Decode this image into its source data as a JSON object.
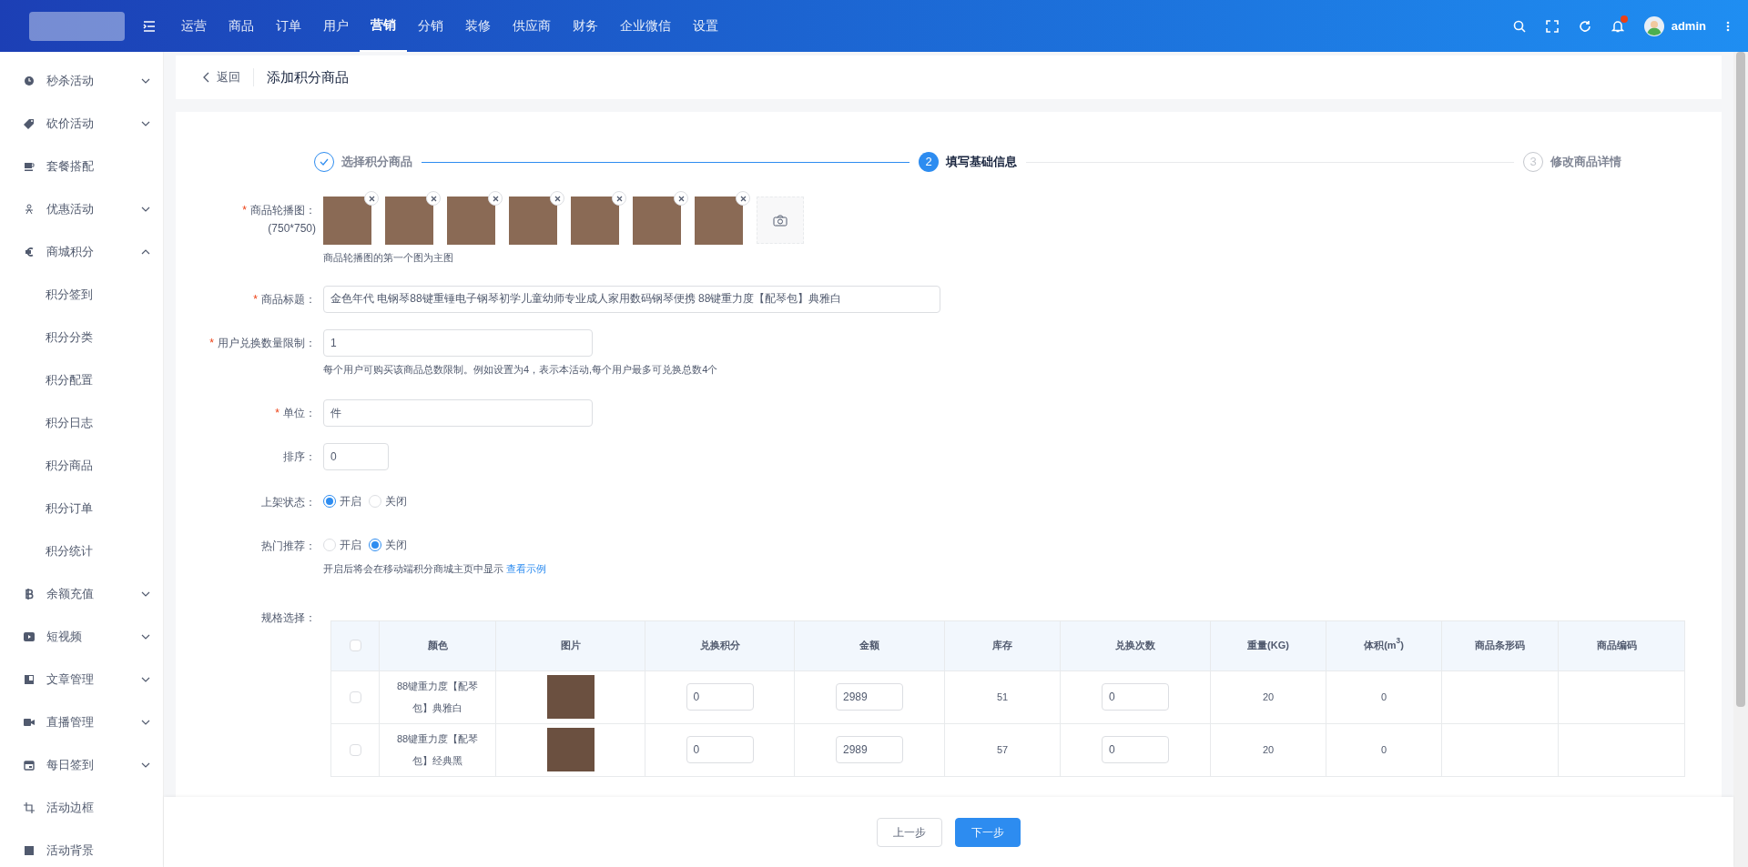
{
  "top_nav": {
    "menu": [
      {
        "label": "运营",
        "selected": false
      },
      {
        "label": "商品",
        "selected": false
      },
      {
        "label": "订单",
        "selected": false
      },
      {
        "label": "用户",
        "selected": false
      },
      {
        "label": "营销",
        "selected": true
      },
      {
        "label": "分销",
        "selected": false
      },
      {
        "label": "装修",
        "selected": false
      },
      {
        "label": "供应商",
        "selected": false
      },
      {
        "label": "财务",
        "selected": false
      },
      {
        "label": "企业微信",
        "selected": false
      },
      {
        "label": "设置",
        "selected": false
      }
    ],
    "has_unread": true,
    "user_name": "admin"
  },
  "sidebar": {
    "items": [
      {
        "label": "秒杀活动",
        "kind": "menu",
        "expanded": false
      },
      {
        "label": "砍价活动",
        "kind": "menu",
        "expanded": false
      },
      {
        "label": "套餐搭配",
        "kind": "link"
      },
      {
        "label": "优惠活动",
        "kind": "menu",
        "expanded": false
      },
      {
        "label": "商城积分",
        "kind": "menu",
        "expanded": true,
        "children": [
          {
            "label": "积分签到"
          },
          {
            "label": "积分分类"
          },
          {
            "label": "积分配置"
          },
          {
            "label": "积分日志"
          },
          {
            "label": "积分商品"
          },
          {
            "label": "积分订单"
          },
          {
            "label": "积分统计"
          }
        ]
      },
      {
        "label": "余额充值",
        "kind": "menu",
        "expanded": false
      },
      {
        "label": "短视频",
        "kind": "menu",
        "expanded": false
      },
      {
        "label": "文章管理",
        "kind": "menu",
        "expanded": false
      },
      {
        "label": "直播管理",
        "kind": "menu",
        "expanded": false
      },
      {
        "label": "每日签到",
        "kind": "menu",
        "expanded": false
      },
      {
        "label": "活动边框",
        "kind": "link"
      },
      {
        "label": "活动背景",
        "kind": "link"
      }
    ]
  },
  "header": {
    "back": "返回",
    "title": "添加积分商品"
  },
  "steps": [
    {
      "label": "选择积分商品",
      "kind": "done"
    },
    {
      "number": "2",
      "label": "填写基础信息",
      "kind": "active"
    },
    {
      "number": "3",
      "label": "修改商品详情",
      "kind": "pending"
    }
  ],
  "form": {
    "carousel": {
      "mark": "*",
      "label": "商品轮播图：",
      "note": "(750*750)",
      "images": [
        {
          "removable": true
        },
        {
          "removable": true
        },
        {
          "removable": true
        },
        {
          "removable": true
        },
        {
          "removable": true
        },
        {
          "removable": true
        },
        {
          "removable": true
        }
      ],
      "hint": "商品轮播图的第一个图为主图"
    },
    "fields": [
      {
        "mark": "*",
        "label": "商品标题：",
        "value": "金色年代 电钢琴88键重锤电子钢琴初学儿童幼师专业成人家用数码钢琴便携 88键重力度【配琴包】典雅白"
      },
      {
        "mark": "*",
        "label": "用户兑换数量限制：",
        "value": "1",
        "hint": "每个用户可购买该商品总数限制。例如设置为4，表示本活动,每个用户最多可兑换总数4个"
      },
      {
        "mark": "*",
        "label": "单位：",
        "value": "件"
      },
      {
        "label": "排序：",
        "value": "0"
      }
    ],
    "radios": [
      {
        "label": "上架状态：",
        "options": [
          {
            "label": "开启",
            "selected": true
          },
          {
            "label": "关闭",
            "selected": false
          }
        ]
      },
      {
        "label": "热门推荐：",
        "options": [
          {
            "label": "开启",
            "selected": false
          },
          {
            "label": "关闭",
            "selected": true
          }
        ],
        "hint": "开启后将会在移动端积分商城主页中显示",
        "link": "查看示例"
      }
    ],
    "spec": {
      "label": "规格选择：",
      "table": {
        "all_checked": false,
        "columns": [
          "颜色",
          "图片",
          "兑换积分",
          "金额",
          "库存",
          "兑换次数",
          "重量(KG)",
          "体积(m$^{3}$)",
          "商品条形码",
          "商品编码"
        ],
        "rows": [
          {
            "checked": false,
            "variant": "88键重力度【配琴包】典雅白",
            "points": "0",
            "amount": "2989",
            "stock": "51",
            "times": "0",
            "weight": "20",
            "volume": "0"
          },
          {
            "checked": false,
            "variant": "88键重力度【配琴包】经典黑",
            "points": "0",
            "amount": "2989",
            "stock": "57",
            "times": "0",
            "weight": "20",
            "volume": "0"
          }
        ]
      }
    }
  },
  "footer": {
    "buttons": [
      {
        "label": "上一步",
        "kind": "default"
      },
      {
        "label": "下一步",
        "kind": "primary"
      }
    ]
  }
}
